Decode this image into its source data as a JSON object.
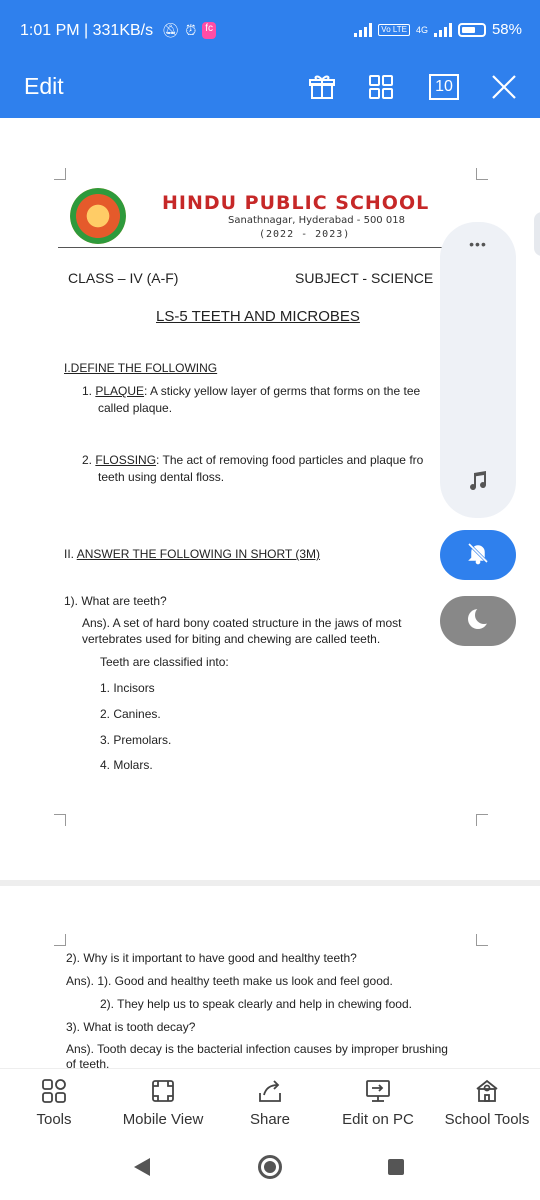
{
  "status_bar": {
    "time": "1:01 PM | 331KB/s",
    "battery": "58%",
    "network": "4G",
    "volte": "Vo LTE",
    "notification_icons": [
      "silent-bell-icon",
      "alarm-icon",
      "fc-app-icon"
    ],
    "fc_icon_label": "fc"
  },
  "app_bar": {
    "edit_label": "Edit",
    "page_count": "10",
    "accent_color": "#2f80ed"
  },
  "document": {
    "school": {
      "name": "HINDU PUBLIC SCHOOL",
      "address": "Sanathnagar, Hyderabad - 500 018",
      "year": "(2022 - 2023)"
    },
    "class_label": "CLASS – IV (A-F)",
    "subject_label": "SUBJECT - SCIENCE",
    "lesson_title": "LS-5 TEETH AND MICROBES",
    "section1": {
      "heading": "I.DEFINE THE FOLLOWING",
      "items": [
        {
          "num": "1.",
          "term": "PLAQUE",
          "rest": ": A sticky yellow layer of germs that forms on the tee",
          "line2": "called plaque."
        },
        {
          "num": "2.",
          "term": "FLOSSING",
          "rest": ": The act of removing food particles and plaque fro",
          "line2": "teeth using dental floss."
        }
      ]
    },
    "section2": {
      "prefix": "II. ",
      "heading": "ANSWER THE FOLLOWING IN SHORT (3M)",
      "q1": "1). What are teeth?",
      "a1_line1": "Ans). A set of hard bony coated structure in the jaws of most",
      "a1_line2": "vertebrates used for biting and chewing are called teeth.",
      "classified": "Teeth are classified into:",
      "types": [
        "1. Incisors",
        "2. Canines.",
        "3. Premolars.",
        "4. Molars."
      ]
    },
    "page2": {
      "q2": "2). Why is it important to have good and healthy teeth?",
      "a2_line1": "Ans). 1).  Good and healthy teeth make us look and feel good.",
      "a2_line2": "2). They help us to speak clearly and help in chewing food.",
      "q3": "3). What is tooth decay?",
      "a3_line1": "Ans). Tooth decay is the bacterial infection causes by improper brushing",
      "a3_line2": "of teeth."
    }
  },
  "floating_panel": {
    "more_dots": "•••",
    "music_icon": "music-note-icon",
    "mute_icon": "bell-off-icon",
    "moon_icon": "moon-icon"
  },
  "toolbar": {
    "tools": "Tools",
    "mobile_view": "Mobile View",
    "share": "Share",
    "edit_on_pc": "Edit on PC",
    "school_tools": "School Tools"
  }
}
